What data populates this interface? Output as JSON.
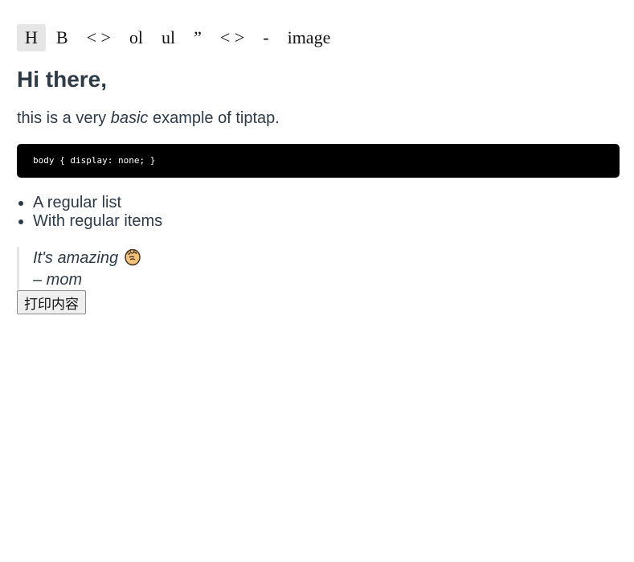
{
  "menubar": {
    "buttons": [
      {
        "label": "H",
        "active": true
      },
      {
        "label": "B",
        "active": false
      },
      {
        "label": "< >",
        "active": false
      },
      {
        "label": "ol",
        "active": false
      },
      {
        "label": "ul",
        "active": false
      },
      {
        "label": "”",
        "active": false
      },
      {
        "label": "< >",
        "active": false
      },
      {
        "label": "-",
        "active": false
      },
      {
        "label": "image",
        "active": false
      }
    ]
  },
  "content": {
    "heading": "Hi there,",
    "intro_before": "this is a very ",
    "intro_em": "basic",
    "intro_after": " example of tiptap.",
    "code": "body { display: none; }",
    "list_items": [
      "A regular list",
      "With regular items"
    ],
    "quote_line1": "It's amazing",
    "quote_emoji": "clapping-hands-icon",
    "quote_line2": "– mom"
  },
  "print_button": {
    "label": "打印内容"
  }
}
